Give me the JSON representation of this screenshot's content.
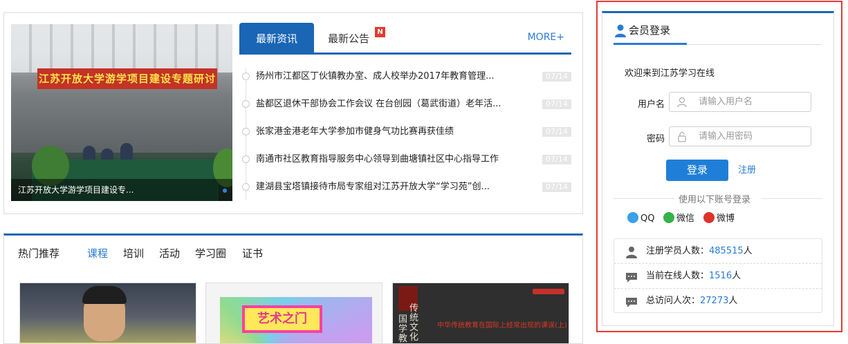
{
  "news": {
    "photo_caption": "江苏开放大学游学项目建设专...",
    "banner_text": "江苏开放大学游学项目建设专题研讨会",
    "tab_active": "最新资讯",
    "tab_normal": "最新公告",
    "tab_badge": "N",
    "more": "MORE+",
    "items": [
      {
        "title": "扬州市江都区丁伙镇教办室、成人校举办2017年教育管理...",
        "date": "07/14"
      },
      {
        "title": "盐都区退休干部协会工作会议 在台创园（葛武街道）老年活...",
        "date": "07/14"
      },
      {
        "title": "张家港金港老年大学参加市健身气功比赛再获佳绩",
        "date": "07/14"
      },
      {
        "title": "南通市社区教育指导服务中心领导到曲塘镇社区中心指导工作",
        "date": "07/14"
      },
      {
        "title": "建湖县宝塔镇接待市局专家组对江苏开放大学“学习苑”创...",
        "date": "07/14"
      }
    ]
  },
  "hot": {
    "title": "热门推荐",
    "tabs": [
      "课程",
      "培训",
      "活动",
      "学习圈",
      "证书"
    ],
    "card2_logo": "艺术之门",
    "card3_vertical": "传统文化",
    "card3_vertical2": "国学教",
    "card3_line": "中华传统教育在国际上经常出现的课误(上)"
  },
  "login": {
    "title": "会员登录",
    "welcome": "欢迎来到江苏学习在线",
    "username_label": "用户名",
    "username_placeholder": "请输入用户名",
    "password_label": "密码",
    "password_placeholder": "请输入用密码",
    "login_button": "登录",
    "register_link": "注册",
    "other_login": "使用以下账号登录",
    "social": [
      {
        "name": "QQ",
        "icon": "qq-icon",
        "color": "#3aa0e8"
      },
      {
        "name": "微信",
        "icon": "wechat-icon",
        "color": "#35b249"
      },
      {
        "name": "微博",
        "icon": "weibo-icon",
        "color": "#e0312b"
      }
    ],
    "stats": [
      {
        "label": "注册学员人数：",
        "value": "485515",
        "unit": "人"
      },
      {
        "label": "当前在线人数：",
        "value": "1516",
        "unit": "人"
      },
      {
        "label": "总访问人次：",
        "value": "27273",
        "unit": "人"
      }
    ]
  },
  "colors": {
    "accent": "#1a66b5",
    "link": "#2a7bd4",
    "highlight_frame": "#e53935"
  }
}
